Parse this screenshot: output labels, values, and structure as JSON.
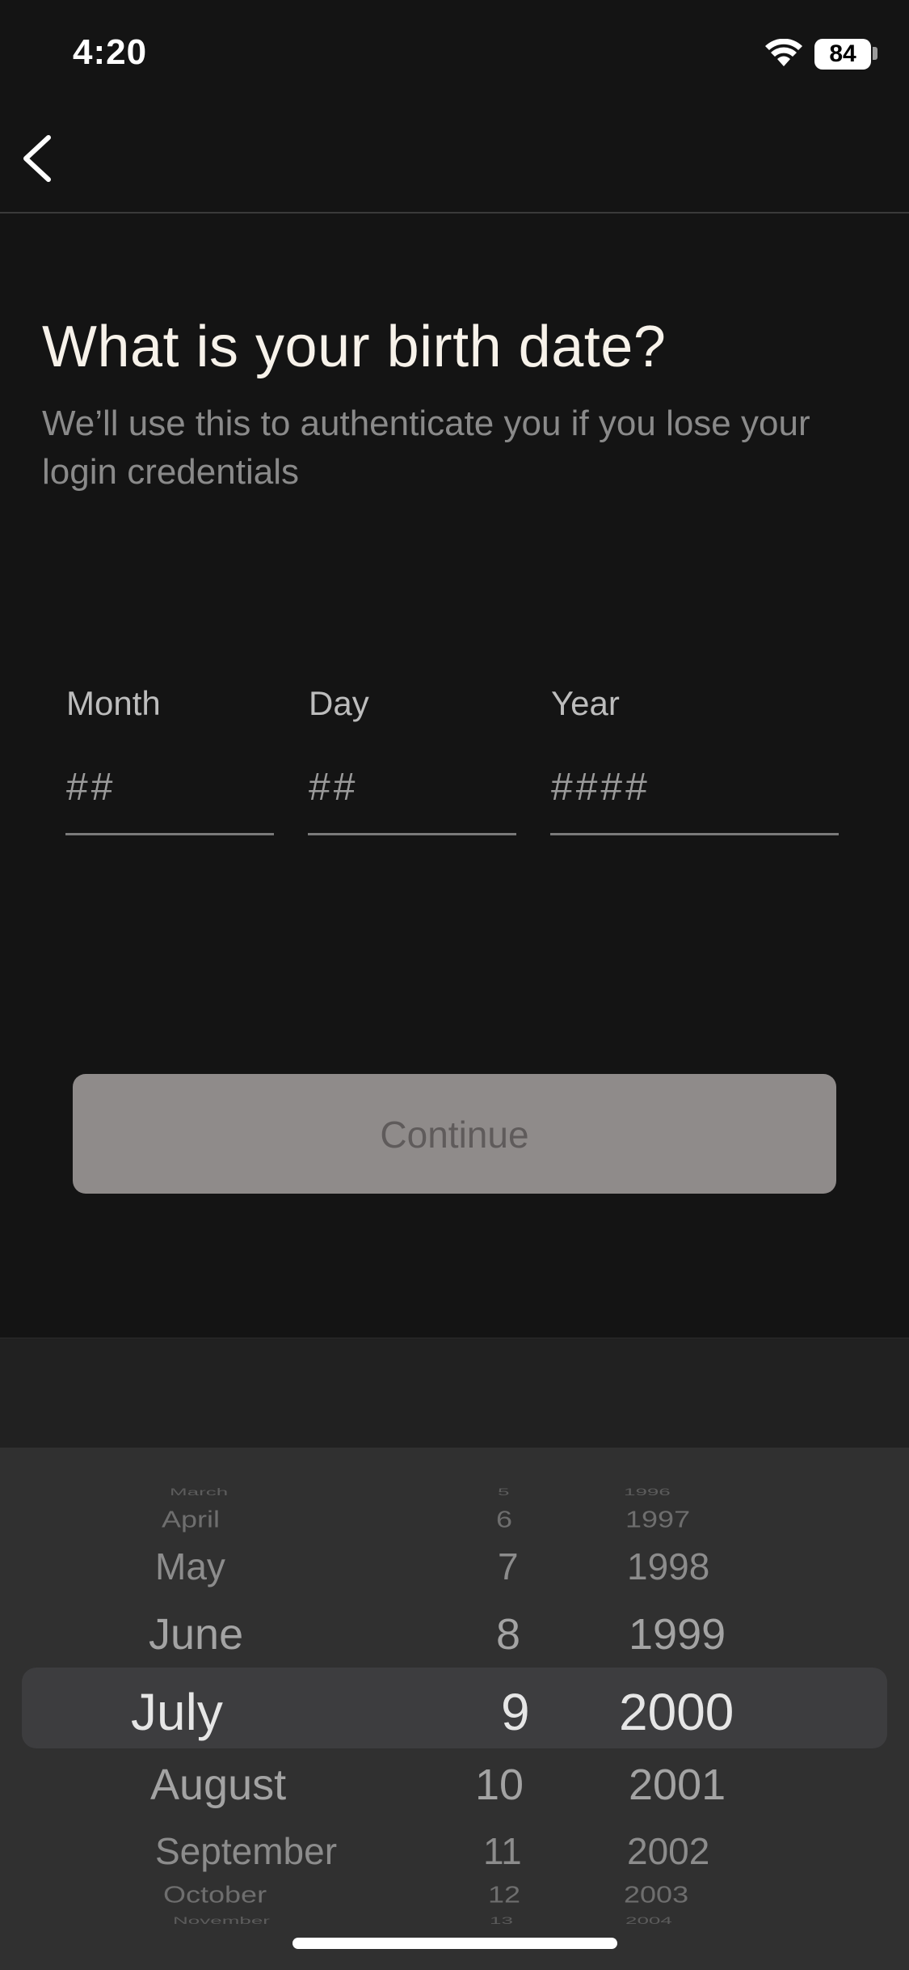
{
  "status_bar": {
    "time": "4:20",
    "battery": "84"
  },
  "heading": {
    "title": "What is your birth date?",
    "subtitle": "We’ll use this to authenticate you if you lose your login credentials"
  },
  "fields": {
    "month": {
      "label": "Month",
      "placeholder": "##"
    },
    "day": {
      "label": "Day",
      "placeholder": "##"
    },
    "year": {
      "label": "Year",
      "placeholder": "####"
    }
  },
  "continue_label": "Continue",
  "picker": {
    "months": [
      "March",
      "April",
      "May",
      "June",
      "July",
      "August",
      "September",
      "October",
      "November"
    ],
    "days": [
      "5",
      "6",
      "7",
      "8",
      "9",
      "10",
      "11",
      "12",
      "13"
    ],
    "years": [
      "1996",
      "1997",
      "1998",
      "1999",
      "2000",
      "2001",
      "2002",
      "2003",
      "2004"
    ],
    "selected": {
      "month": "July",
      "day": "9",
      "year": "2000"
    }
  },
  "colors": {
    "background": "#141414",
    "button_disabled": "#8f8b8a",
    "picker_bg": "#303030"
  }
}
